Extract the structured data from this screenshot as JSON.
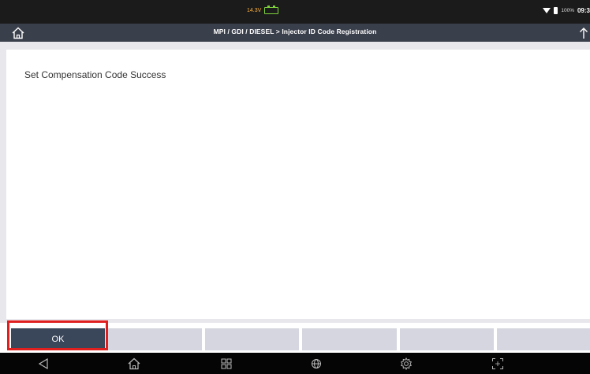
{
  "status_bar": {
    "voltage": "14.3V",
    "battery_percent": "100%",
    "time": "09:3",
    "icons": [
      "car-battery-icon",
      "wifi-icon",
      "device-battery-icon"
    ]
  },
  "header": {
    "breadcrumb": "MPI / GDI / DIESEL  >  Injector ID Code Registration",
    "left_icon": "home-icon",
    "right_icon": "upload-arrow-icon"
  },
  "main": {
    "message": "Set Compensation Code Success"
  },
  "buttons": {
    "ok_label": "OK",
    "slot_2_label": "",
    "slot_3_label": "",
    "slot_4_label": "",
    "slot_5_label": "",
    "slot_6_label": ""
  },
  "nav_bar": {
    "icons": [
      "back-icon",
      "home-icon",
      "recent-apps-icon",
      "globe-icon",
      "settings-icon",
      "screenshot-icon"
    ]
  },
  "colors": {
    "header_bg": "#3a3f4c",
    "primary_button": "#3a4659",
    "inactive_button": "#d5d6df",
    "highlight": "#e0201f",
    "voltage_text": "#ffb23f",
    "battery_icon": "#7fd23c"
  }
}
